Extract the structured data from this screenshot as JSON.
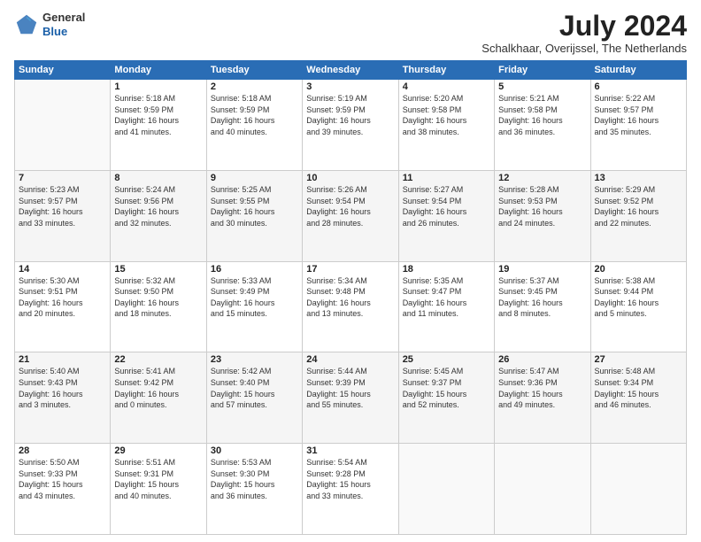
{
  "header": {
    "logo": {
      "line1": "General",
      "line2": "Blue"
    },
    "title": "July 2024",
    "location": "Schalkhaar, Overijssel, The Netherlands"
  },
  "weekdays": [
    "Sunday",
    "Monday",
    "Tuesday",
    "Wednesday",
    "Thursday",
    "Friday",
    "Saturday"
  ],
  "weeks": [
    [
      {
        "day": "",
        "info": ""
      },
      {
        "day": "1",
        "info": "Sunrise: 5:18 AM\nSunset: 9:59 PM\nDaylight: 16 hours\nand 41 minutes."
      },
      {
        "day": "2",
        "info": "Sunrise: 5:18 AM\nSunset: 9:59 PM\nDaylight: 16 hours\nand 40 minutes."
      },
      {
        "day": "3",
        "info": "Sunrise: 5:19 AM\nSunset: 9:59 PM\nDaylight: 16 hours\nand 39 minutes."
      },
      {
        "day": "4",
        "info": "Sunrise: 5:20 AM\nSunset: 9:58 PM\nDaylight: 16 hours\nand 38 minutes."
      },
      {
        "day": "5",
        "info": "Sunrise: 5:21 AM\nSunset: 9:58 PM\nDaylight: 16 hours\nand 36 minutes."
      },
      {
        "day": "6",
        "info": "Sunrise: 5:22 AM\nSunset: 9:57 PM\nDaylight: 16 hours\nand 35 minutes."
      }
    ],
    [
      {
        "day": "7",
        "info": "Sunrise: 5:23 AM\nSunset: 9:57 PM\nDaylight: 16 hours\nand 33 minutes."
      },
      {
        "day": "8",
        "info": "Sunrise: 5:24 AM\nSunset: 9:56 PM\nDaylight: 16 hours\nand 32 minutes."
      },
      {
        "day": "9",
        "info": "Sunrise: 5:25 AM\nSunset: 9:55 PM\nDaylight: 16 hours\nand 30 minutes."
      },
      {
        "day": "10",
        "info": "Sunrise: 5:26 AM\nSunset: 9:54 PM\nDaylight: 16 hours\nand 28 minutes."
      },
      {
        "day": "11",
        "info": "Sunrise: 5:27 AM\nSunset: 9:54 PM\nDaylight: 16 hours\nand 26 minutes."
      },
      {
        "day": "12",
        "info": "Sunrise: 5:28 AM\nSunset: 9:53 PM\nDaylight: 16 hours\nand 24 minutes."
      },
      {
        "day": "13",
        "info": "Sunrise: 5:29 AM\nSunset: 9:52 PM\nDaylight: 16 hours\nand 22 minutes."
      }
    ],
    [
      {
        "day": "14",
        "info": "Sunrise: 5:30 AM\nSunset: 9:51 PM\nDaylight: 16 hours\nand 20 minutes."
      },
      {
        "day": "15",
        "info": "Sunrise: 5:32 AM\nSunset: 9:50 PM\nDaylight: 16 hours\nand 18 minutes."
      },
      {
        "day": "16",
        "info": "Sunrise: 5:33 AM\nSunset: 9:49 PM\nDaylight: 16 hours\nand 15 minutes."
      },
      {
        "day": "17",
        "info": "Sunrise: 5:34 AM\nSunset: 9:48 PM\nDaylight: 16 hours\nand 13 minutes."
      },
      {
        "day": "18",
        "info": "Sunrise: 5:35 AM\nSunset: 9:47 PM\nDaylight: 16 hours\nand 11 minutes."
      },
      {
        "day": "19",
        "info": "Sunrise: 5:37 AM\nSunset: 9:45 PM\nDaylight: 16 hours\nand 8 minutes."
      },
      {
        "day": "20",
        "info": "Sunrise: 5:38 AM\nSunset: 9:44 PM\nDaylight: 16 hours\nand 5 minutes."
      }
    ],
    [
      {
        "day": "21",
        "info": "Sunrise: 5:40 AM\nSunset: 9:43 PM\nDaylight: 16 hours\nand 3 minutes."
      },
      {
        "day": "22",
        "info": "Sunrise: 5:41 AM\nSunset: 9:42 PM\nDaylight: 16 hours\nand 0 minutes."
      },
      {
        "day": "23",
        "info": "Sunrise: 5:42 AM\nSunset: 9:40 PM\nDaylight: 15 hours\nand 57 minutes."
      },
      {
        "day": "24",
        "info": "Sunrise: 5:44 AM\nSunset: 9:39 PM\nDaylight: 15 hours\nand 55 minutes."
      },
      {
        "day": "25",
        "info": "Sunrise: 5:45 AM\nSunset: 9:37 PM\nDaylight: 15 hours\nand 52 minutes."
      },
      {
        "day": "26",
        "info": "Sunrise: 5:47 AM\nSunset: 9:36 PM\nDaylight: 15 hours\nand 49 minutes."
      },
      {
        "day": "27",
        "info": "Sunrise: 5:48 AM\nSunset: 9:34 PM\nDaylight: 15 hours\nand 46 minutes."
      }
    ],
    [
      {
        "day": "28",
        "info": "Sunrise: 5:50 AM\nSunset: 9:33 PM\nDaylight: 15 hours\nand 43 minutes."
      },
      {
        "day": "29",
        "info": "Sunrise: 5:51 AM\nSunset: 9:31 PM\nDaylight: 15 hours\nand 40 minutes."
      },
      {
        "day": "30",
        "info": "Sunrise: 5:53 AM\nSunset: 9:30 PM\nDaylight: 15 hours\nand 36 minutes."
      },
      {
        "day": "31",
        "info": "Sunrise: 5:54 AM\nSunset: 9:28 PM\nDaylight: 15 hours\nand 33 minutes."
      },
      {
        "day": "",
        "info": ""
      },
      {
        "day": "",
        "info": ""
      },
      {
        "day": "",
        "info": ""
      }
    ]
  ]
}
